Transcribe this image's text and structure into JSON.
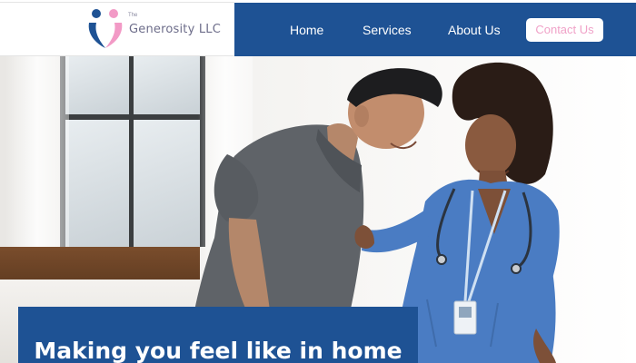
{
  "brand": {
    "prefix": "The",
    "name": "Generosity LLC"
  },
  "nav": {
    "home": "Home",
    "services": "Services",
    "about": "About  Us",
    "contact": "Contact Us"
  },
  "hero": {
    "headline": "Making you feel like in home"
  },
  "colors": {
    "primary": "#1e5294",
    "accent_pink": "#f0a2c8",
    "logo_blue": "#1e5294",
    "logo_pink": "#f29ac6"
  }
}
